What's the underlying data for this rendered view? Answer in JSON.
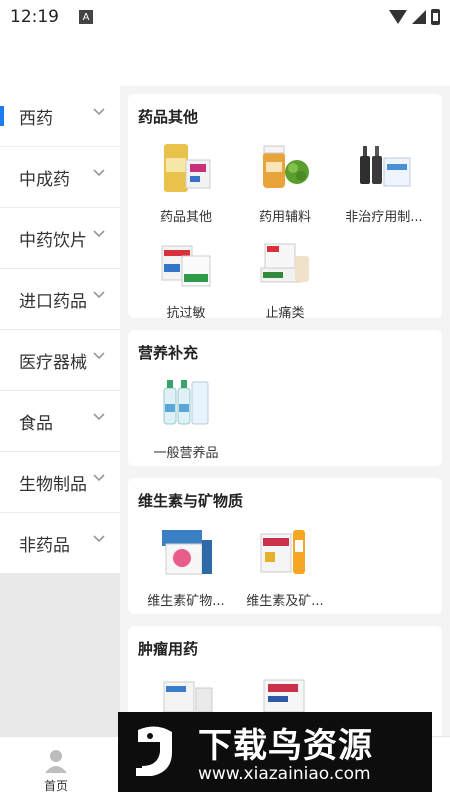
{
  "status_bar": {
    "time": "12:19",
    "notification_glyph": "A"
  },
  "sidebar": {
    "items": [
      {
        "label": "西药",
        "active": true
      },
      {
        "label": "中成药",
        "active": false
      },
      {
        "label": "中药饮片",
        "active": false
      },
      {
        "label": "进口药品",
        "active": false
      },
      {
        "label": "医疗器械",
        "active": false
      },
      {
        "label": "食品",
        "active": false
      },
      {
        "label": "生物制品",
        "active": false
      },
      {
        "label": "非药品",
        "active": false
      }
    ]
  },
  "sections": [
    {
      "title": "药品其他",
      "items": [
        {
          "label": "药品其他",
          "icon": "medicine-box-icon"
        },
        {
          "label": "药用辅料",
          "icon": "excipient-jar-icon"
        },
        {
          "label": "非治疗用制...",
          "icon": "bottles-icon"
        },
        {
          "label": "抗过敏",
          "icon": "antiallergy-box-icon"
        },
        {
          "label": "止痛类",
          "icon": "painkiller-box-icon"
        }
      ]
    },
    {
      "title": "营养补充",
      "items": [
        {
          "label": "一般营养品",
          "icon": "nutrition-bottles-icon"
        }
      ]
    },
    {
      "title": "维生素与矿物质",
      "items": [
        {
          "label": "维生素矿物...",
          "icon": "vitamin-box-icon"
        },
        {
          "label": "维生素及矿...",
          "icon": "vitamin-tube-icon"
        }
      ]
    },
    {
      "title": "肿瘤用药",
      "items": []
    }
  ],
  "bottom_nav": {
    "home_label": "首页"
  },
  "watermark": {
    "title": "下载鸟资源",
    "url": "www.xiazainiao.com"
  },
  "colors": {
    "accent": "#1e7cf2",
    "background": "#f4f4f4"
  }
}
